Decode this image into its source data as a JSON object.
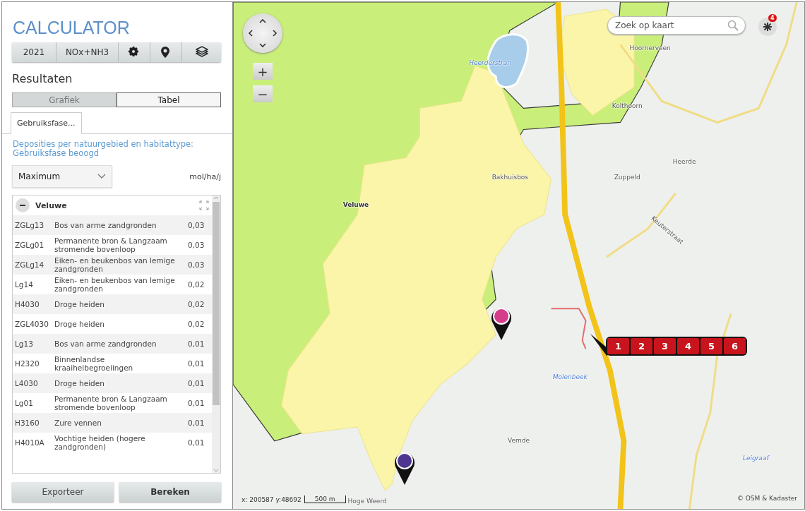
{
  "app": {
    "title": "CALCULATOR"
  },
  "toolbar": [
    {
      "kind": "text",
      "label": "2021"
    },
    {
      "kind": "text",
      "label": "NOx+NH3"
    },
    {
      "kind": "icon"
    },
    {
      "kind": "icon"
    },
    {
      "kind": "icon"
    }
  ],
  "results": {
    "heading": "Resultaten",
    "view_tabs": [
      {
        "label": "Grafiek",
        "selected": false
      },
      {
        "label": "Tabel",
        "selected": true
      }
    ],
    "phase_tabs": [
      {
        "label": "Gebruiksfase...",
        "selected": true
      }
    ],
    "description": "Deposities per natuurgebied en habitattype: Gebruiksfase beoogd",
    "dropdown": {
      "value": "Maximum"
    },
    "unit": "mol/ha/j",
    "group": {
      "name": "Veluwe",
      "expanded": true
    },
    "rows": [
      {
        "code": "ZGLg13",
        "name": "Bos van arme zandgronden",
        "value": "0,03"
      },
      {
        "code": "ZGLg01",
        "name": "Permanente bron & Langzaam stromende bovenloop",
        "value": "0,03"
      },
      {
        "code": "ZGLg14",
        "name": "Eiken- en beukenbos van lemige zandgronden",
        "value": "0,03"
      },
      {
        "code": "Lg14",
        "name": "Eiken- en beukenbos van lemige zandgronden",
        "value": "0,02"
      },
      {
        "code": "H4030",
        "name": "Droge heiden",
        "value": "0,02"
      },
      {
        "code": "ZGL4030",
        "name": "Droge heiden",
        "value": "0,02"
      },
      {
        "code": "Lg13",
        "name": "Bos van arme zandgronden",
        "value": "0,01"
      },
      {
        "code": "H2320",
        "name": "Binnenlandse kraaiheibegroeiingen",
        "value": "0,01"
      },
      {
        "code": "L4030",
        "name": "Droge heiden",
        "value": "0,01"
      },
      {
        "code": "Lg01",
        "name": "Permanente bron & Langzaam stromende bovenloop",
        "value": "0,01"
      },
      {
        "code": "H3160",
        "name": "Zure vennen",
        "value": "0,01"
      },
      {
        "code": "H4010A",
        "name": "Vochtige heiden (hogere zandgronden)",
        "value": "0,01"
      }
    ],
    "buttons": [
      {
        "label": "Exporteer",
        "primary": false
      },
      {
        "label": "Bereken",
        "primary": true
      }
    ]
  },
  "map": {
    "search": {
      "placeholder": "Zoek op kaart"
    },
    "notification_badge": "4",
    "places": [
      {
        "name": "Heerderstran",
        "kind": "water"
      },
      {
        "name": "Hoornerveen",
        "kind": "place"
      },
      {
        "name": "Kolthoorn",
        "kind": "place"
      },
      {
        "name": "Bakhuisbos",
        "kind": "place"
      },
      {
        "name": "Heerde",
        "kind": "place"
      },
      {
        "name": "Zuppeld",
        "kind": "place"
      },
      {
        "name": "Veluwe",
        "kind": "area"
      },
      {
        "name": "Keuterstraat",
        "kind": "road"
      },
      {
        "name": "Molenbeek",
        "kind": "water"
      },
      {
        "name": "Vemde",
        "kind": "place"
      },
      {
        "name": "Hoge Weerd",
        "kind": "place"
      },
      {
        "name": "Leigraaf",
        "kind": "water"
      }
    ],
    "markers": [
      {
        "color": "#d43d8a"
      },
      {
        "color": "#4e3590"
      }
    ],
    "zoom_buttons": [
      "+",
      "−"
    ],
    "source_labels": [
      "1",
      "2",
      "3",
      "4",
      "5",
      "6"
    ],
    "coordinates": "x: 200587 y:48692",
    "scale": "500 m",
    "attribution": "© OSM & Kadaster"
  }
}
